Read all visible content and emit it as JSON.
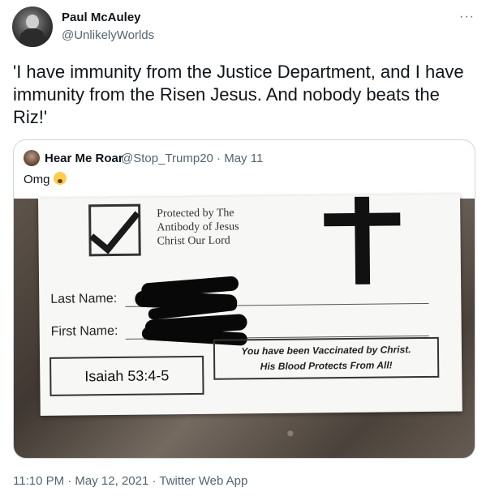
{
  "author": {
    "name": "Paul McAuley",
    "handle": "@UnlikelyWorlds"
  },
  "more_icon": "···",
  "tweet_text": "'I have immunity from the Justice Department, and I have immunity from the Risen Jesus. And nobody beats the Riz!'",
  "quoted": {
    "name": "Hear Me Roar",
    "meta": "@Stop_Trump20 · May 11",
    "text": "Omg",
    "emoji": "astonished-face-emoji",
    "card": {
      "protected_text": "Protected by The Antibody of Jesus Christ Our Lord",
      "last_name_label": "Last Name:",
      "first_name_label": "First Name:",
      "reference": "Isaiah 53:4-5",
      "vaccinated_line1": "You have been Vaccinated by Christ.",
      "vaccinated_line2": "His Blood Protects From All!"
    }
  },
  "footer": "11:10 PM · May 12, 2021 · Twitter Web App"
}
